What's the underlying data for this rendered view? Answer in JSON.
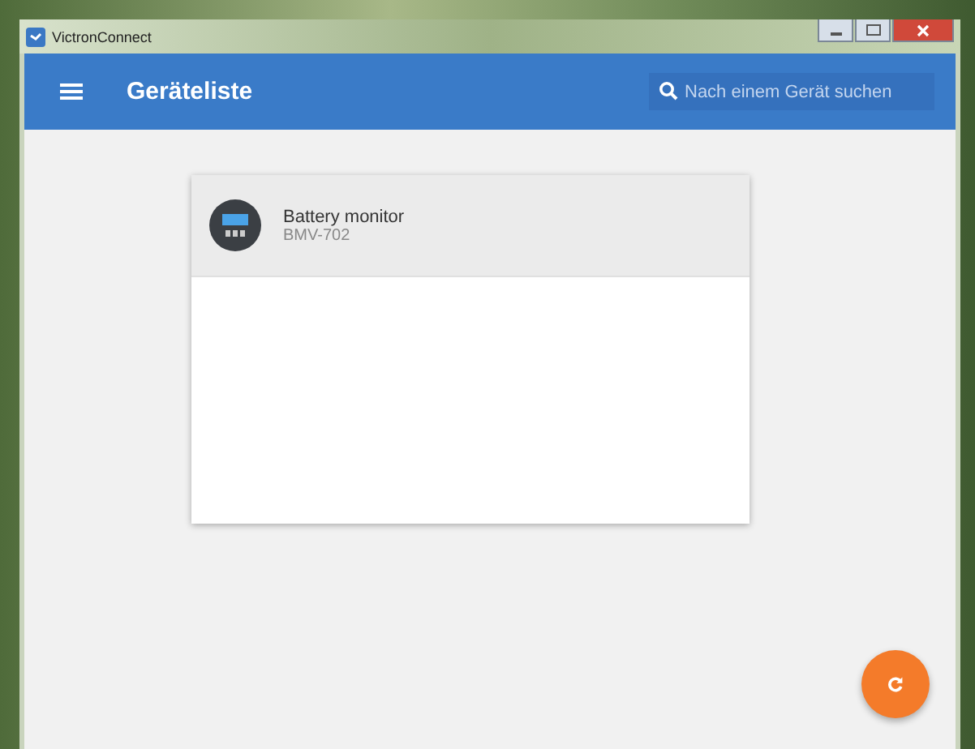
{
  "window": {
    "title": "VictronConnect"
  },
  "app_bar": {
    "title": "Geräteliste",
    "search": {
      "placeholder": "Nach einem Gerät suchen"
    }
  },
  "devices": [
    {
      "name": "Battery monitor",
      "model": "BMV-702"
    }
  ]
}
